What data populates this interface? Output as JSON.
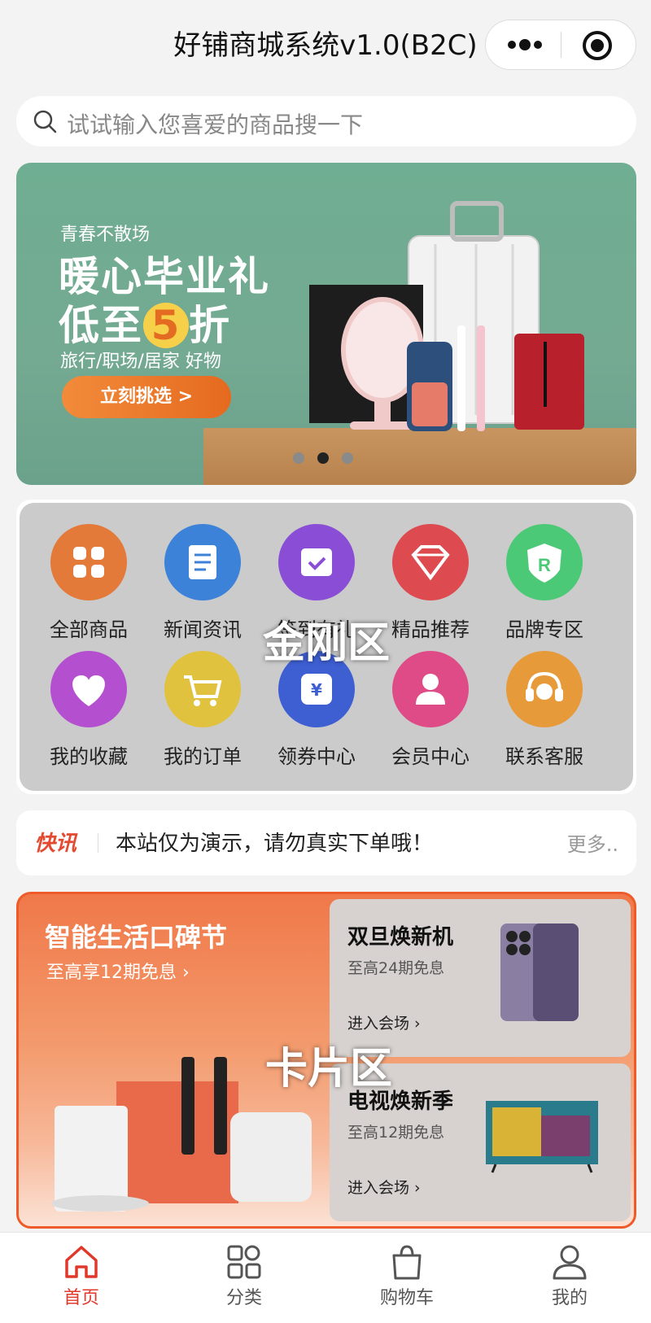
{
  "nav": {
    "title": "好铺商城系统v1.0(B2C)"
  },
  "search": {
    "placeholder": "试试输入您喜爱的商品搜一下"
  },
  "banner": {
    "tag": "青春不散场",
    "headline": "暖心毕业礼",
    "headline2_prefix": "低至",
    "headline2_num": "5",
    "headline2_suffix": "折",
    "subline": "旅行/职场/居家 好物",
    "cta": "立刻挑选 >",
    "pager": {
      "count": 3,
      "active": 1
    }
  },
  "kingkong": {
    "overlay": "金刚区",
    "items": [
      {
        "label": "全部商品",
        "color": "#e47a3a",
        "icon": "grid-icon"
      },
      {
        "label": "新闻资讯",
        "color": "#3c82d8",
        "icon": "news-icon"
      },
      {
        "label": "签到有礼",
        "color": "#8a4ed6",
        "icon": "calendar-icon"
      },
      {
        "label": "精品推荐",
        "color": "#dd4a4f",
        "icon": "diamond-icon"
      },
      {
        "label": "品牌专区",
        "color": "#4cc977",
        "icon": "brand-icon"
      },
      {
        "label": "我的收藏",
        "color": "#b44fd0",
        "icon": "heart-icon"
      },
      {
        "label": "我的订单",
        "color": "#e0c23f",
        "icon": "cart-icon"
      },
      {
        "label": "领券中心",
        "color": "#3d5fd2",
        "icon": "coupon-icon"
      },
      {
        "label": "会员中心",
        "color": "#df4b86",
        "icon": "member-icon"
      },
      {
        "label": "联系客服",
        "color": "#e69a3a",
        "icon": "service-icon"
      }
    ]
  },
  "news": {
    "tag": "快讯",
    "text": "本站仅为演示，请勿真实下单哦！",
    "more": "更多.."
  },
  "cards": {
    "overlay": "卡片区",
    "title": "智能生活口碑节",
    "subtitle": "至高享12期免息 ›",
    "items": [
      {
        "title": "双旦焕新机",
        "sub": "至高24期免息",
        "link": "进入会场 ›"
      },
      {
        "title": "电视焕新季",
        "sub": "至高12期免息",
        "link": "进入会场 ›"
      }
    ]
  },
  "tabbar": {
    "active_color": "#e0392b",
    "items": [
      {
        "label": "首页",
        "icon": "home-icon"
      },
      {
        "label": "分类",
        "icon": "category-icon"
      },
      {
        "label": "购物车",
        "icon": "shopping-bag-icon"
      },
      {
        "label": "我的",
        "icon": "user-icon"
      }
    ]
  }
}
